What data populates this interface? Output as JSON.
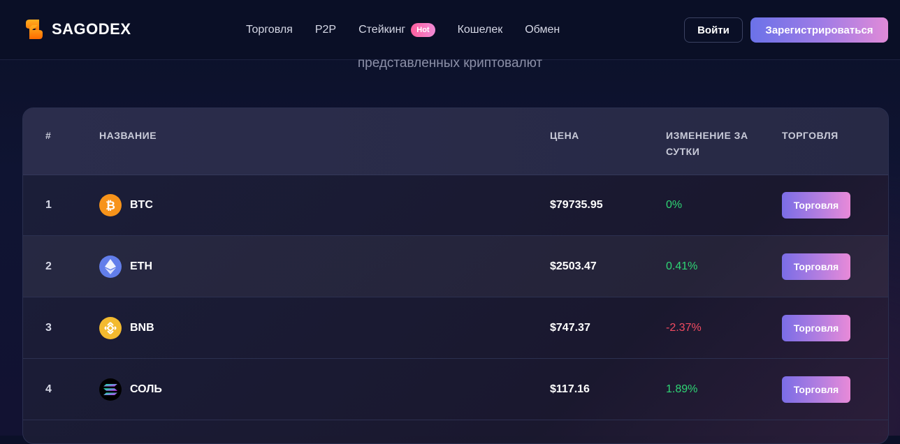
{
  "brand": {
    "name": "SAGODEX"
  },
  "nav": {
    "items": [
      {
        "label": "Торговля"
      },
      {
        "label": "P2P"
      },
      {
        "label": "Стейкинг",
        "badge": "Hot"
      },
      {
        "label": "Кошелек"
      },
      {
        "label": "Обмен"
      }
    ]
  },
  "auth": {
    "login_label": "Войти",
    "register_label": "Зарегистрироваться"
  },
  "subtitle": "представленных криптовалют",
  "table": {
    "headers": {
      "num": "#",
      "name": "НАЗВАНИЕ",
      "price": "ЦЕНА",
      "change_line1": "ИЗМЕНЕНИЕ ЗА",
      "change_line2": "СУТКИ",
      "trade": "ТОРГОВЛЯ"
    },
    "rows": [
      {
        "num": "1",
        "name": "BTC",
        "price": "$79735.95",
        "change": "0%",
        "trade_label": "Торговля",
        "icon": "bitcoin-icon",
        "trend": "positive"
      },
      {
        "num": "2",
        "name": "ETH",
        "price": "$2503.47",
        "change": "0.41%",
        "trade_label": "Торговля",
        "icon": "ethereum-icon",
        "trend": "positive"
      },
      {
        "num": "3",
        "name": "BNB",
        "price": "$747.37",
        "change": "-2.37%",
        "trade_label": "Торговля",
        "icon": "bnb-icon",
        "trend": "negative"
      },
      {
        "num": "4",
        "name": "СОЛЬ",
        "price": "$117.16",
        "change": "1.89%",
        "trade_label": "Торговля",
        "icon": "solana-icon",
        "trend": "positive"
      }
    ]
  },
  "colors": {
    "accent_gradient_start": "#6b72e8",
    "accent_gradient_end": "#e08ad8",
    "positive": "#2fd675",
    "negative": "#f24b61",
    "hot_badge": "#ff5f9e"
  }
}
